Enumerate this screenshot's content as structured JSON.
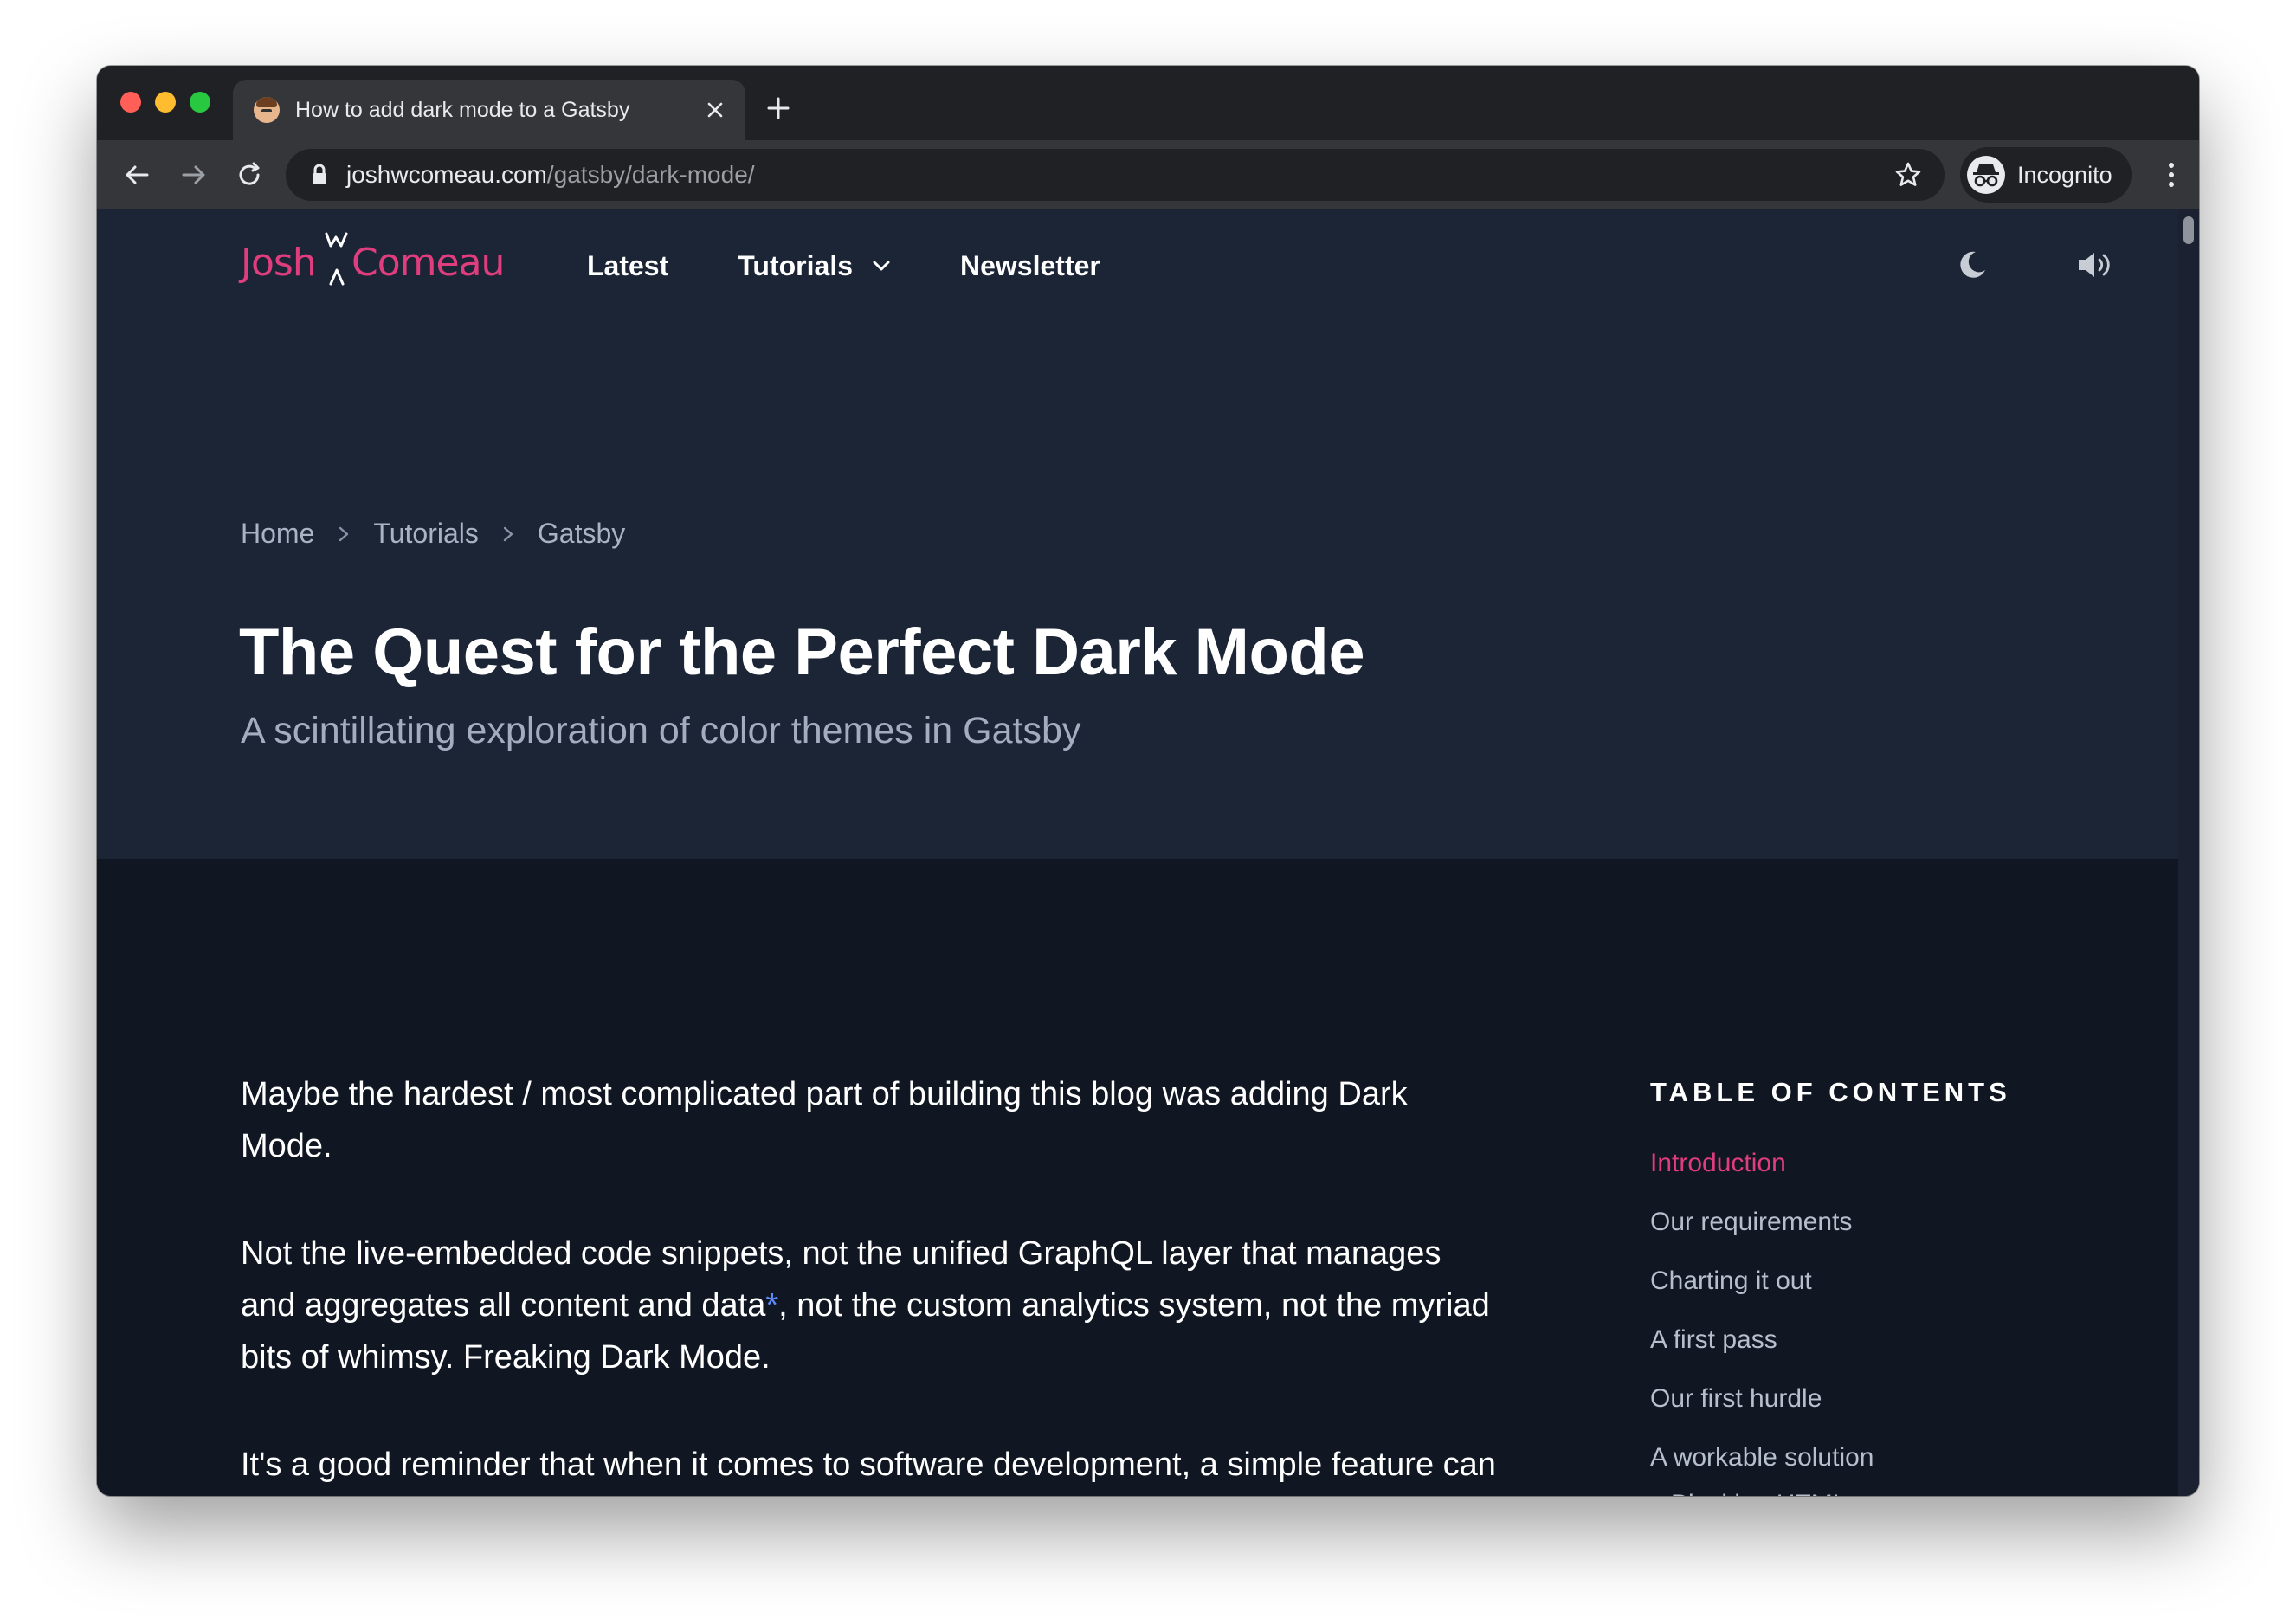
{
  "browser": {
    "tab": {
      "title": "How to add dark mode to a Gatsby"
    },
    "url": {
      "domain": "joshwcomeau.com",
      "path": "/gatsby/dark-mode/"
    },
    "profile_label": "Incognito"
  },
  "site": {
    "logo": {
      "first": "Josh",
      "last": "Comeau"
    },
    "nav": {
      "latest": "Latest",
      "tutorials": "Tutorials",
      "newsletter": "Newsletter"
    }
  },
  "breadcrumb": [
    "Home",
    "Tutorials",
    "Gatsby"
  ],
  "article": {
    "title": "The Quest for the Perfect Dark Mode",
    "subtitle": "A scintillating exploration of color themes in Gatsby",
    "p1": "Maybe the hardest / most complicated part of building this blog was adding Dark Mode.",
    "p2_before": "Not the live-embedded code snippets, not the unified GraphQL layer that manages and aggregates all content and data",
    "p2_footnote": "*",
    "p2_after": ", not the custom analytics system, not the myriad bits of whimsy. Freaking Dark Mode.",
    "p3": "It's a good reminder that when it comes to software development, a simple feature can have a complex implementation."
  },
  "toc": {
    "heading": "TABLE OF CONTENTS",
    "items": [
      "Introduction",
      "Our requirements",
      "Charting it out",
      "A first pass",
      "Our first hurdle",
      "A workable solution",
      "Blocking HTML"
    ]
  },
  "colors": {
    "accent_pink": "#e03d7e",
    "hero_bg": "#1b2536",
    "body_bg": "#111722",
    "footnote_blue": "#5d8cff"
  }
}
